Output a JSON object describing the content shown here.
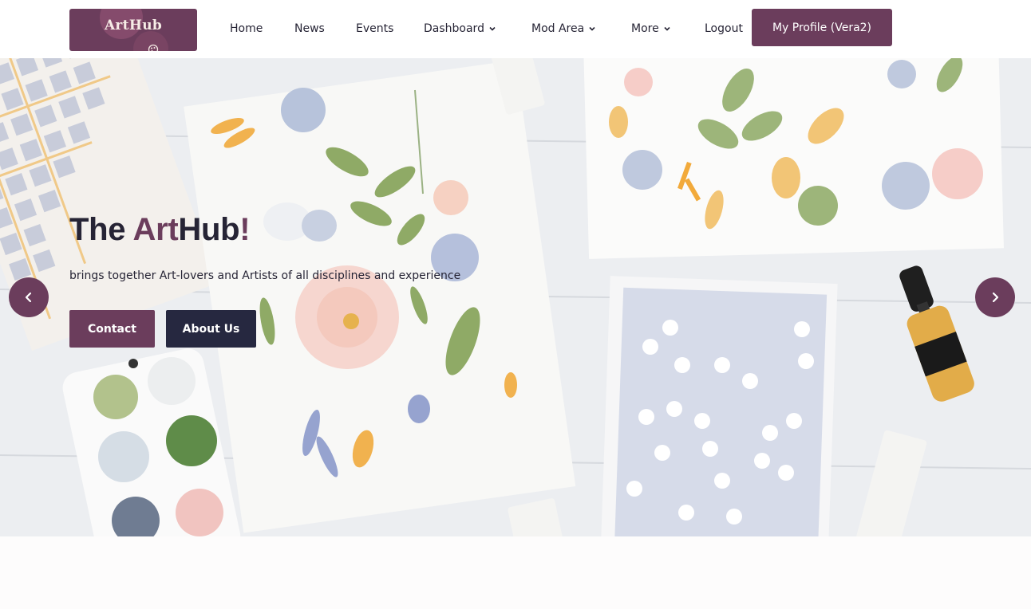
{
  "brand": {
    "name": "ArtHub",
    "primary": "#6b3d5c",
    "dark": "#262840"
  },
  "nav": {
    "items": [
      {
        "label": "Home"
      },
      {
        "label": "News"
      },
      {
        "label": "Events"
      },
      {
        "label": "Dashboard",
        "icon": "chevron-down-icon"
      },
      {
        "label": "Mod Area",
        "icon": "chevron-down-icon"
      },
      {
        "label": "More",
        "icon": "chevron-down-icon"
      },
      {
        "label": "Logout"
      }
    ],
    "profile_label": "My Profile (Vera2)"
  },
  "hero": {
    "title_part1": "The ",
    "title_part2": "Art",
    "title_part3": "Hub",
    "title_part4": "!",
    "subtitle": "brings together Art-lovers and Artists of all disciplines and experience",
    "contact_label": "Contact",
    "about_label": "About Us",
    "prev_icon": "chevron-left-icon",
    "next_icon": "chevron-right-icon"
  }
}
